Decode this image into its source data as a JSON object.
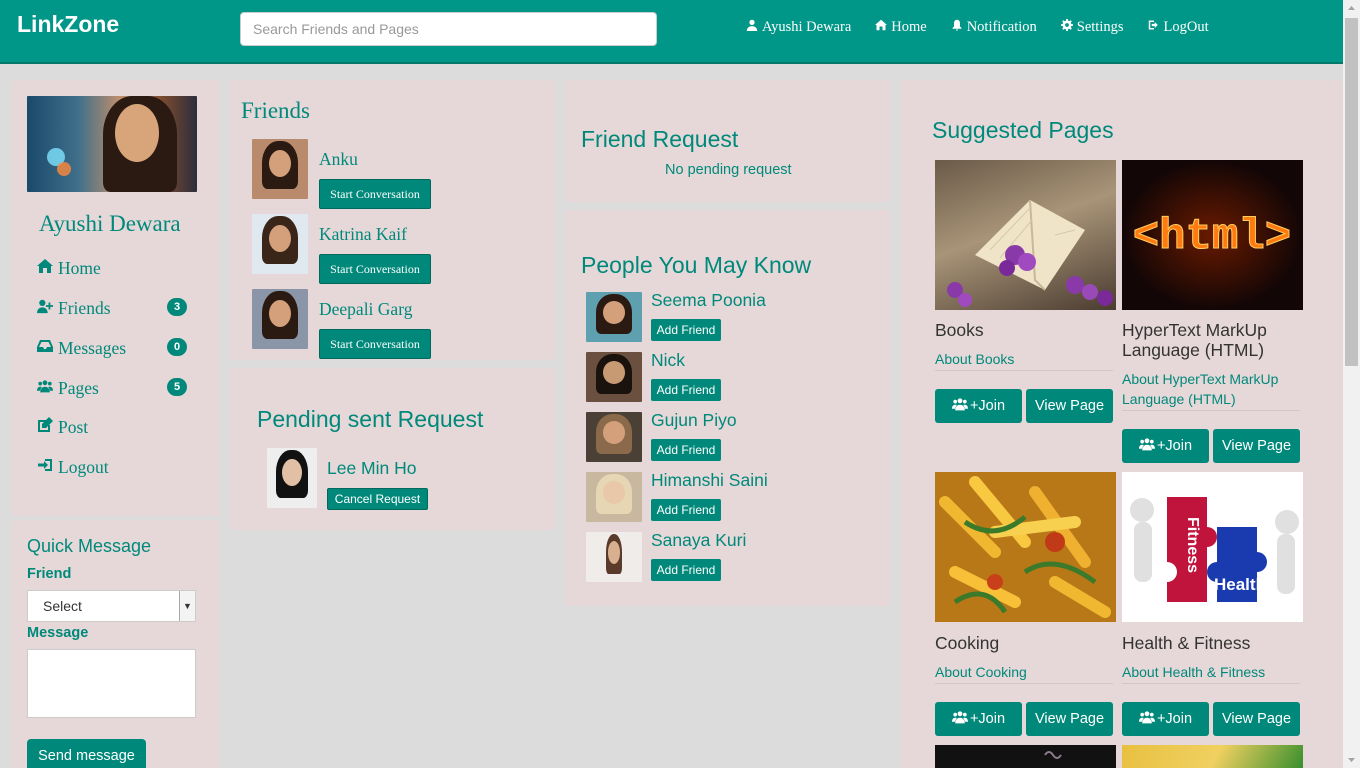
{
  "navbar": {
    "brand": "LinkZone",
    "search_placeholder": "Search Friends and Pages",
    "links": [
      {
        "label": "Ayushi Dewara",
        "icon": "user-icon"
      },
      {
        "label": "Home",
        "icon": "home-icon"
      },
      {
        "label": "Notification",
        "icon": "bell-icon"
      },
      {
        "label": "Settings",
        "icon": "gear-icon"
      },
      {
        "label": "LogOut",
        "icon": "logout-icon"
      }
    ]
  },
  "sidebar": {
    "username": "Ayushi Dewara",
    "menu": [
      {
        "label": "Home",
        "icon": "home-icon",
        "badge": null
      },
      {
        "label": "Friends",
        "icon": "user-plus-icon",
        "badge": "3"
      },
      {
        "label": "Messages",
        "icon": "inbox-icon",
        "badge": "0"
      },
      {
        "label": "Pages",
        "icon": "users-icon",
        "badge": "5"
      },
      {
        "label": "Post",
        "icon": "edit-icon",
        "badge": null
      },
      {
        "label": "Logout",
        "icon": "sign-out-icon",
        "badge": null
      }
    ]
  },
  "quick_message": {
    "title": "Quick Message",
    "friend_label": "Friend",
    "select_value": "Select",
    "message_label": "Message",
    "send_label": "Send message"
  },
  "friends": {
    "title": "Friends",
    "items": [
      {
        "name": "Anku",
        "button": "Start Conversation"
      },
      {
        "name": "Katrina Kaif",
        "button": "Start Conversation"
      },
      {
        "name": "Deepali Garg",
        "button": "Start Conversation"
      }
    ]
  },
  "pending_sent": {
    "title": "Pending sent Request",
    "items": [
      {
        "name": "Lee Min Ho",
        "button": "Cancel Request"
      }
    ]
  },
  "friend_request": {
    "title": "Friend Request",
    "empty_text": "No pending request"
  },
  "people_you_may_know": {
    "title": "People You May Know",
    "items": [
      {
        "name": "Seema Poonia",
        "button": "Add Friend"
      },
      {
        "name": "Nick",
        "button": "Add Friend"
      },
      {
        "name": "Gujun Piyo",
        "button": "Add Friend"
      },
      {
        "name": "Himanshi Saini",
        "button": "Add Friend"
      },
      {
        "name": "Sanaya Kuri",
        "button": "Add Friend"
      }
    ]
  },
  "suggested_pages": {
    "title": "Suggested Pages",
    "join_label": "+Join",
    "view_label": "View Page",
    "items": [
      {
        "name": "Books",
        "about": "About Books"
      },
      {
        "name": "HyperText MarkUp Language (HTML)",
        "about": "About HyperText MarkUp Language (HTML)",
        "image_text": "<html>"
      },
      {
        "name": "Cooking",
        "about": "About Cooking"
      },
      {
        "name": "Health & Fitness",
        "about": "About Health & Fitness",
        "image_text_1": "Fitness",
        "image_text_2": "Health"
      }
    ]
  },
  "colors": {
    "primary": "#009688",
    "accent": "#00897b",
    "panel": "#e6d8d8",
    "background": "#dcdcdc"
  }
}
